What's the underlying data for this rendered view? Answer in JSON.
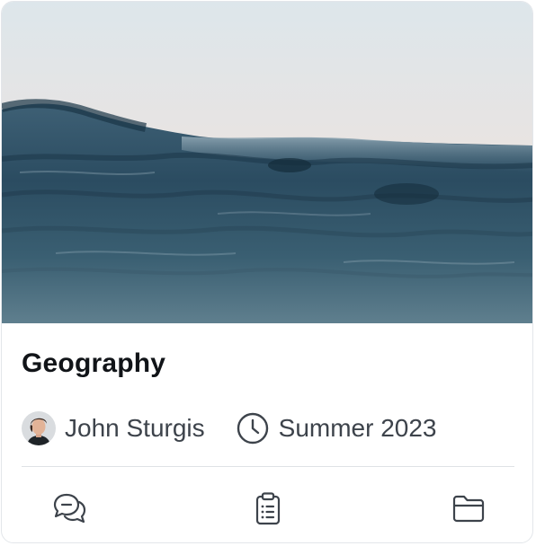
{
  "card": {
    "title": "Geography",
    "cover_image": "ocean-waves-photo",
    "author": {
      "name": "John Sturgis",
      "avatar": "person-avatar"
    },
    "term": {
      "icon": "clock-icon",
      "label": "Summer 2023"
    },
    "actions": [
      {
        "name": "discussions",
        "icon": "chat-bubbles-icon"
      },
      {
        "name": "assignments",
        "icon": "clipboard-list-icon"
      },
      {
        "name": "files",
        "icon": "folder-icon"
      }
    ]
  },
  "colors": {
    "icon_stroke": "#3d434b",
    "title": "#111418",
    "divider": "#dfe2e6",
    "sky_top": "#dfe6ea",
    "sky_horizon": "#f3ddd2",
    "water_dark": "#1e3a4d"
  }
}
